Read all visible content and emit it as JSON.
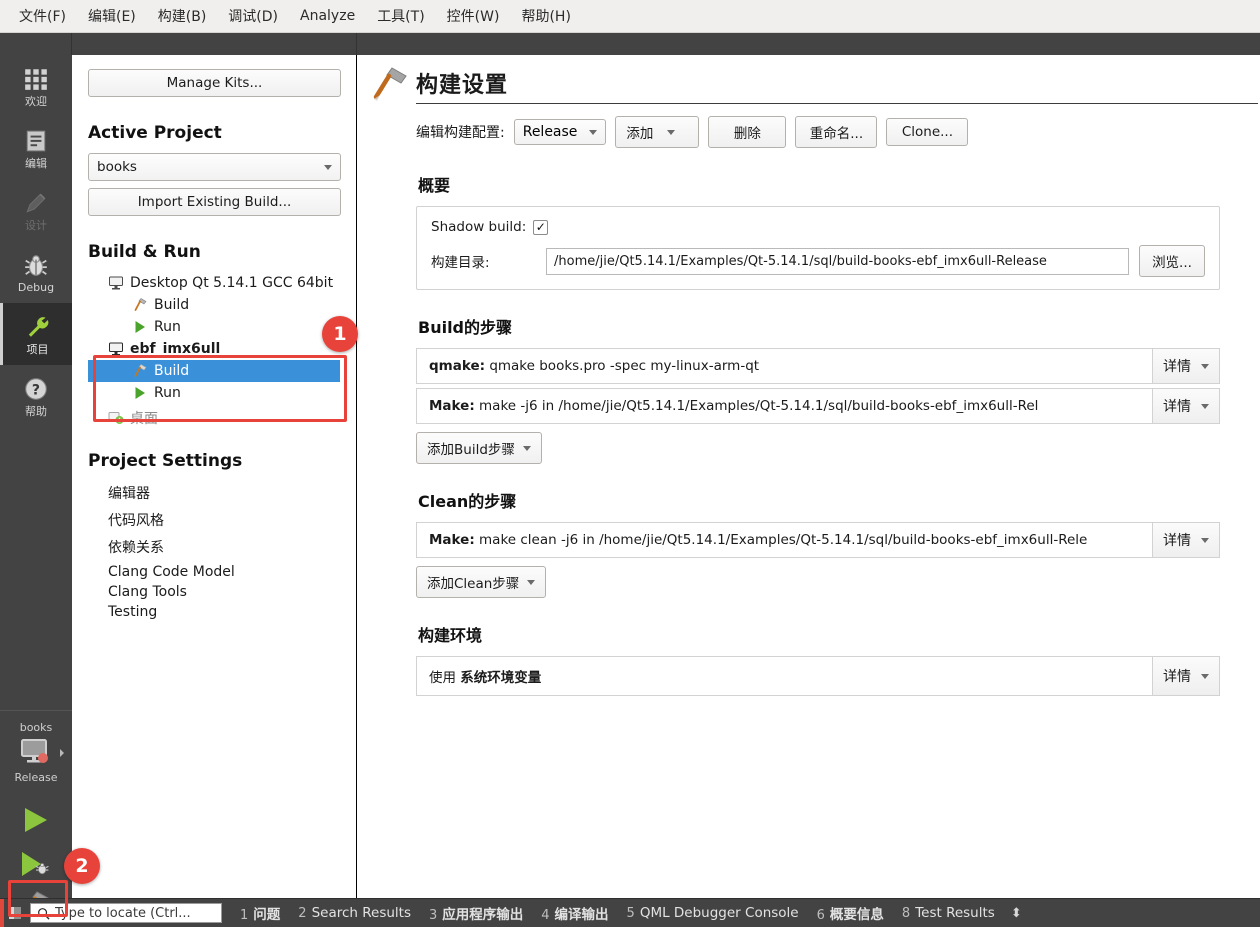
{
  "menubar": {
    "items": [
      {
        "label": "文件(F)",
        "mnemonic": "F"
      },
      {
        "label": "编辑(E)",
        "mnemonic": "E"
      },
      {
        "label": "构建(B)",
        "mnemonic": "B"
      },
      {
        "label": "调试(D)",
        "mnemonic": "D"
      },
      {
        "label": "Analyze",
        "mnemonic": "A"
      },
      {
        "label": "工具(T)",
        "mnemonic": "T"
      },
      {
        "label": "控件(W)",
        "mnemonic": "W"
      },
      {
        "label": "帮助(H)",
        "mnemonic": "H"
      }
    ]
  },
  "modebar": {
    "items": [
      {
        "label": "欢迎",
        "icon": "grid-icon",
        "state": "normal"
      },
      {
        "label": "编辑",
        "icon": "document-icon",
        "state": "normal"
      },
      {
        "label": "设计",
        "icon": "pencil-icon",
        "state": "disabled"
      },
      {
        "label": "Debug",
        "icon": "bug-icon",
        "state": "normal"
      },
      {
        "label": "项目",
        "icon": "wrench-icon",
        "state": "active"
      },
      {
        "label": "帮助",
        "icon": "question-icon",
        "state": "normal"
      }
    ],
    "kit_selector": {
      "project": "books",
      "config": "Release",
      "icon": "desktop-icon",
      "run_icon": "run-icon",
      "debug_icon": "run-debug-icon",
      "build_icon": "hammer-icon"
    }
  },
  "leftpanel": {
    "manage_kits": "Manage Kits...",
    "active_project_title": "Active Project",
    "active_project_value": "books",
    "import_build": "Import Existing Build...",
    "build_run_title": "Build & Run",
    "tree": [
      {
        "label": "Desktop Qt 5.14.1 GCC 64bit",
        "icon": "desktop-icon",
        "level": 0,
        "bold": false,
        "selected": false,
        "muted": false
      },
      {
        "label": "Build",
        "icon": "hammer-icon",
        "level": 1,
        "bold": false,
        "selected": false,
        "muted": false
      },
      {
        "label": "Run",
        "icon": "run-icon",
        "level": 1,
        "bold": false,
        "selected": false,
        "muted": false
      },
      {
        "label": "ebf_imx6ull",
        "icon": "desktop-icon",
        "level": 0,
        "bold": true,
        "selected": false,
        "muted": false
      },
      {
        "label": "Build",
        "icon": "hammer-icon",
        "level": 1,
        "bold": false,
        "selected": true,
        "muted": false
      },
      {
        "label": "Run",
        "icon": "run-icon",
        "level": 1,
        "bold": false,
        "selected": false,
        "muted": false
      },
      {
        "label": "桌面",
        "icon": "add-desktop-icon",
        "level": 0,
        "bold": false,
        "selected": false,
        "muted": true
      }
    ],
    "project_settings_title": "Project Settings",
    "settings": [
      "编辑器",
      "代码风格",
      "依赖关系",
      "Clang Code Model",
      "Clang Tools",
      "Testing"
    ]
  },
  "main": {
    "title": "构建设置",
    "title_icon": "hammer-icon",
    "config_label": "编辑构建配置:",
    "config_value": "Release",
    "buttons": {
      "add": "添加",
      "remove": "删除",
      "rename": "重命名...",
      "clone": "Clone..."
    },
    "summary": {
      "title": "概要",
      "shadow_build_label": "Shadow build:",
      "shadow_build_checked": "✓",
      "build_dir_label": "构建目录:",
      "build_dir_value": "/home/jie/Qt5.14.1/Examples/Qt-5.14.1/sql/build-books-ebf_imx6ull-Release",
      "browse_label": "浏览..."
    },
    "build_steps": {
      "title": "Build的步骤",
      "detail_label": "详情",
      "add_label": "添加Build步骤",
      "steps": [
        {
          "name": "qmake:",
          "command": "qmake books.pro -spec my-linux-arm-qt"
        },
        {
          "name": "Make:",
          "command": "make -j6 in /home/jie/Qt5.14.1/Examples/Qt-5.14.1/sql/build-books-ebf_imx6ull-Rel"
        }
      ]
    },
    "clean_steps": {
      "title": "Clean的步骤",
      "detail_label": "详情",
      "add_label": "添加Clean步骤",
      "steps": [
        {
          "name": "Make:",
          "command": "make clean -j6 in /home/jie/Qt5.14.1/Examples/Qt-5.14.1/sql/build-books-ebf_imx6ull-Rele"
        }
      ]
    },
    "build_env": {
      "title": "构建环境",
      "value_prefix": "使用 ",
      "value": "系统环境变量",
      "detail_label": "详情"
    }
  },
  "statusbar": {
    "locator_placeholder": "Type to locate (Ctrl...",
    "items": [
      {
        "num": "1",
        "label": "问题",
        "cn": true
      },
      {
        "num": "2",
        "label": "Search Results",
        "cn": false
      },
      {
        "num": "3",
        "label": "应用程序输出",
        "cn": true
      },
      {
        "num": "4",
        "label": "编译输出",
        "cn": true
      },
      {
        "num": "5",
        "label": "QML Debugger Console",
        "cn": false
      },
      {
        "num": "6",
        "label": "概要信息",
        "cn": true
      },
      {
        "num": "8",
        "label": "Test Results",
        "cn": false
      }
    ],
    "arrows": "⬍"
  },
  "annotations": {
    "badge1": "1",
    "badge2": "2",
    "accent_color": "#e8433a",
    "selection_color": "#3a91d9"
  }
}
